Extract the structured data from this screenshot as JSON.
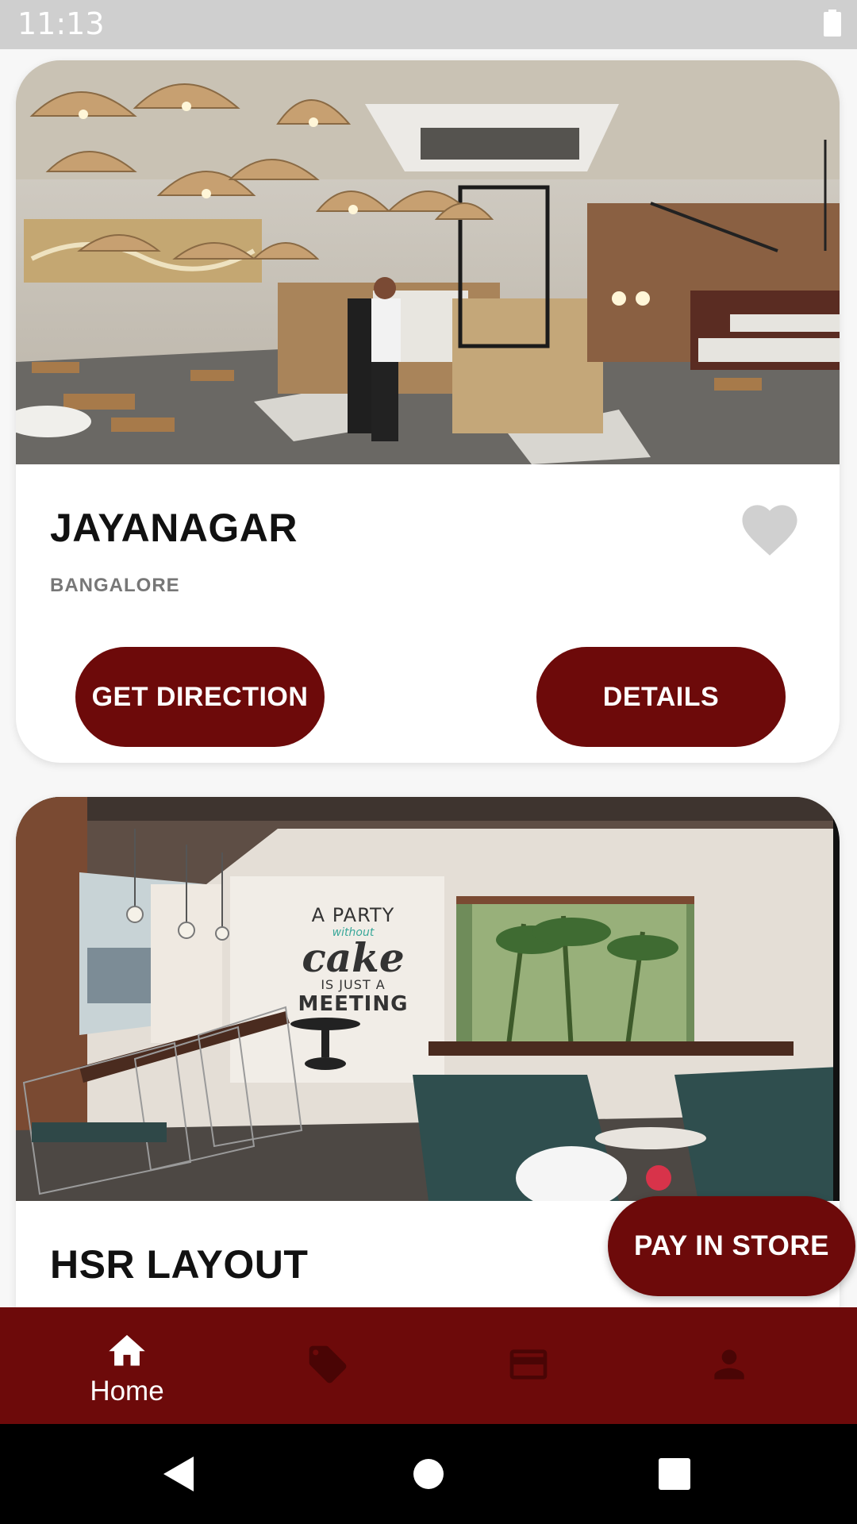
{
  "status_bar": {
    "time": "11:13"
  },
  "stores": [
    {
      "name": "JAYANAGAR",
      "city": "BANGALORE",
      "primary_action": "GET DIRECTION",
      "secondary_action": "DETAILS"
    },
    {
      "name": "HSR LAYOUT",
      "wall_text": {
        "line1": "A PARTY",
        "line2": "without",
        "line3": "cake",
        "line4": "IS JUST A",
        "line5": "MEETING"
      }
    }
  ],
  "floating_action": {
    "label": "PAY IN STORE"
  },
  "bottom_nav": {
    "items": [
      {
        "icon": "home-icon",
        "label": "Home",
        "active": true
      },
      {
        "icon": "tag-icon",
        "active": false
      },
      {
        "icon": "card-icon",
        "active": false
      },
      {
        "icon": "person-icon",
        "active": false
      }
    ]
  },
  "colors": {
    "accent": "#6d0a0a",
    "inactive_icon": "#4a0505",
    "heart": "#d0d0d0"
  }
}
